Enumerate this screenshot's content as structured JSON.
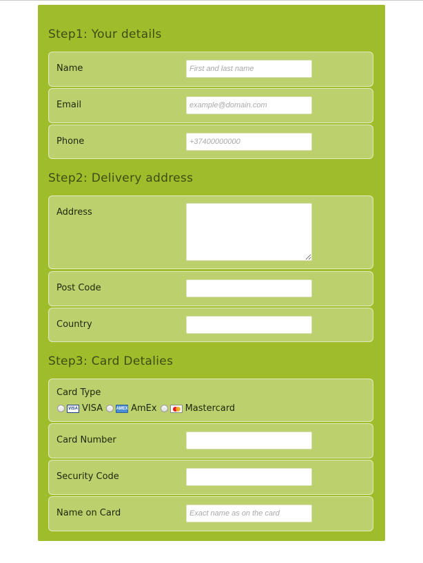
{
  "form": {
    "step1": {
      "title": "Step1: Your details",
      "name": {
        "label": "Name",
        "placeholder": "First and last name"
      },
      "email": {
        "label": "Email",
        "placeholder": "example@domain.com"
      },
      "phone": {
        "label": "Phone",
        "placeholder": "+37400000000"
      }
    },
    "step2": {
      "title": "Step2: Delivery address",
      "address": {
        "label": "Address",
        "placeholder": ""
      },
      "post_code": {
        "label": "Post Code",
        "placeholder": ""
      },
      "country": {
        "label": "Country",
        "placeholder": ""
      }
    },
    "step3": {
      "title": "Step3: Card Detalies",
      "card_type": {
        "label": "Card Type",
        "options": [
          {
            "label": "VISA",
            "icon": "visa-card-icon",
            "icon_text": "VISA"
          },
          {
            "label": "AmEx",
            "icon": "amex-card-icon",
            "icon_text": "AMEX"
          },
          {
            "label": "Mastercard",
            "icon": "mastercard-icon"
          }
        ]
      },
      "card_number": {
        "label": "Card Number",
        "placeholder": ""
      },
      "security_code": {
        "label": "Security Code",
        "placeholder": ""
      },
      "name_on_card": {
        "label": "Name on Card",
        "placeholder": "Exact name as on the card"
      }
    }
  },
  "colors": {
    "panel": "#9fbd2a",
    "row": "#bcd16e",
    "title_text": "#3b4d14"
  }
}
